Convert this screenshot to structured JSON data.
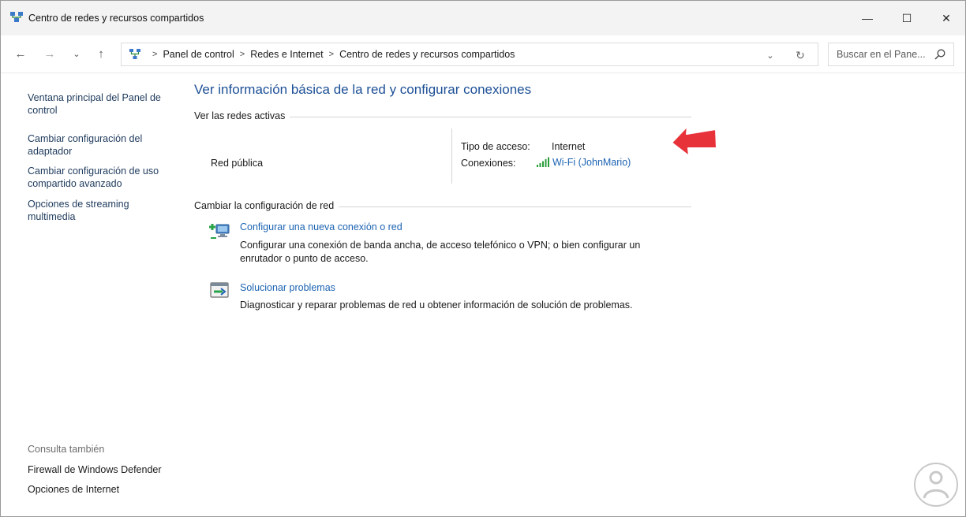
{
  "window": {
    "title": "Centro de redes y recursos compartidos",
    "icon": "network-center-icon"
  },
  "controls": {
    "minimize": "—",
    "maximize": "☐",
    "close": "✕"
  },
  "nav": {
    "back": "←",
    "forward": "→",
    "recent": "⌄",
    "up": "↑",
    "breadcrumbs": [
      "Panel de control",
      "Redes e Internet",
      "Centro de redes y recursos compartidos"
    ],
    "dropdown": "⌄",
    "refresh": "↻",
    "search_placeholder": "Buscar en el Pane..."
  },
  "sidebar": {
    "links": [
      "Ventana principal del Panel de control",
      "Cambiar configuración del adaptador",
      "Cambiar configuración de uso compartido avanzado",
      "Opciones de streaming multimedia"
    ],
    "see_also_label": "Consulta también",
    "see_also": [
      "Firewall de Windows Defender",
      "Opciones de Internet"
    ]
  },
  "main": {
    "title": "Ver información básica de la red y configurar conexiones",
    "active_section": "Ver las redes activas",
    "network_name": "Red pública",
    "access_label": "Tipo de acceso:",
    "access_value": "Internet",
    "connections_label": "Conexiones:",
    "connection_link": "Wi-Fi (JohnMario)",
    "change_section": "Cambiar la configuración de red",
    "tasks": [
      {
        "title": "Configurar una nueva conexión o red",
        "description": "Configurar una conexión de banda ancha, de acceso telefónico o VPN; o bien configurar un enrutador o punto de acceso."
      },
      {
        "title": "Solucionar problemas",
        "description": "Diagnosticar y reparar problemas de red u obtener información de solución de problemas."
      }
    ]
  },
  "colors": {
    "link": "#1c63b3",
    "title": "#1c4f96",
    "annotation_arrow": "#e8323a"
  }
}
